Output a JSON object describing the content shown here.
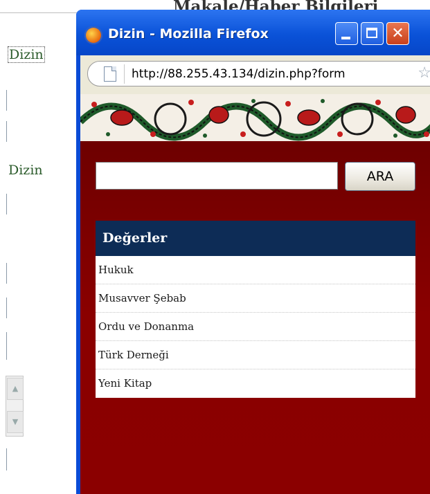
{
  "background_page": {
    "heading": "Makale/Haber Bilgileri",
    "links": [
      "Dizin",
      "Dizin"
    ]
  },
  "window": {
    "title": "Dizin - Mozilla Firefox",
    "url": "http://88.255.43.134/dizin.php?form",
    "icons": {
      "app": "firefox-icon",
      "page": "page-icon",
      "bookmark": "star-icon",
      "minimize": "minimize-icon",
      "maximize": "maximize-icon",
      "close": "close-icon"
    },
    "colors": {
      "titlebar": "#0a52d8",
      "content_bg": "#6f0000",
      "table_header_bg": "#0d2c56"
    }
  },
  "search": {
    "value": "",
    "button_label": "ARA"
  },
  "results": {
    "header": "Değerler",
    "rows": [
      "Hukuk",
      "Musavver Şebab",
      "Ordu ve Donanma",
      "Türk Derneği",
      "Yeni Kitap"
    ]
  }
}
